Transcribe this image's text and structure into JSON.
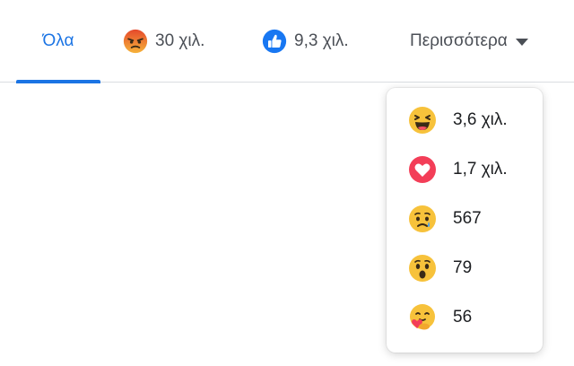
{
  "tabs": {
    "all": {
      "label": "Όλα",
      "active": true
    },
    "angry": {
      "icon": "angry-reaction-icon",
      "count": "30 χιλ."
    },
    "like": {
      "icon": "like-reaction-icon",
      "count": "9,3 χιλ."
    },
    "more": {
      "label": "Περισσότερα",
      "icon": "caret-down-icon"
    }
  },
  "dropdown": {
    "items": [
      {
        "icon": "haha-reaction-icon",
        "count": "3,6 χιλ."
      },
      {
        "icon": "love-reaction-icon",
        "count": "1,7 χιλ."
      },
      {
        "icon": "sad-reaction-icon",
        "count": "567"
      },
      {
        "icon": "wow-reaction-icon",
        "count": "79"
      },
      {
        "icon": "care-reaction-icon",
        "count": "56"
      }
    ]
  },
  "colors": {
    "accent": "#1b74e4",
    "text": "#1c1e21",
    "muted": "#4b4f56",
    "divider": "#dadde1",
    "like_blue": "#1877f2",
    "emoji_yellow": "#f7c23b",
    "angry_orange": "#e9711c",
    "love_red": "#f33e58"
  }
}
